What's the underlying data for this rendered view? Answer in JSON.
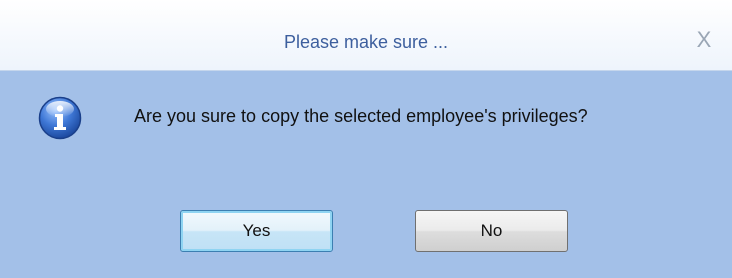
{
  "dialog": {
    "title": "Please make sure ...",
    "close_glyph": "X",
    "icon": "information-icon",
    "message": "Are you sure to copy the selected employee's privileges?",
    "buttons": {
      "yes_label": "Yes",
      "no_label": "No"
    }
  },
  "colors": {
    "body_background": "#a3c0e8",
    "title_text": "#3d5f9e",
    "info_icon_blue": "#2f5fb5"
  }
}
